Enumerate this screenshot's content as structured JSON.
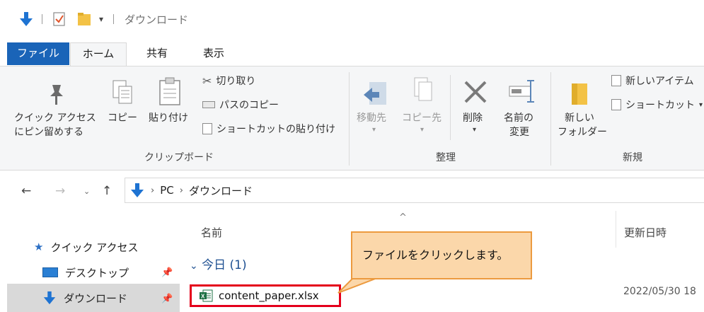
{
  "window": {
    "title": "ダウンロード",
    "quick_access_toolbar": [
      "down-arrow-icon",
      "properties-check-icon",
      "folder-icon",
      "customize-dropdown-icon"
    ]
  },
  "ribbon_tabs": [
    {
      "label": "ファイル",
      "active": false
    },
    {
      "label": "ホーム",
      "active": true
    },
    {
      "label": "共有",
      "active": false
    },
    {
      "label": "表示",
      "active": false
    }
  ],
  "ribbon": {
    "clipboard": {
      "pin_label_1": "クイック アクセス",
      "pin_label_2": "にピン留めする",
      "copy_label": "コピー",
      "paste_label": "貼り付け",
      "cut_label": "切り取り",
      "copy_path_label": "パスのコピー",
      "paste_shortcut_label": "ショートカットの貼り付け",
      "group_name": "クリップボード"
    },
    "organize": {
      "move_to_label": "移動先",
      "copy_to_label": "コピー先",
      "delete_label": "削除",
      "rename_label_1": "名前の",
      "rename_label_2": "変更",
      "group_name": "整理"
    },
    "new": {
      "new_folder_label_1": "新しい",
      "new_folder_label_2": "フォルダー",
      "new_item_label": "新しいアイテム",
      "easy_access_label": "ショートカット",
      "group_name": "新規"
    }
  },
  "address": {
    "path": [
      "PC",
      "ダウンロード"
    ]
  },
  "nav_pane": {
    "items": [
      {
        "label": "クイック アクセス",
        "icon": "star-icon"
      },
      {
        "label": "デスクトップ",
        "icon": "desktop-icon",
        "pinned": true
      },
      {
        "label": "ダウンロード",
        "icon": "download-icon",
        "pinned": true,
        "selected": true
      }
    ]
  },
  "file_list": {
    "columns": [
      "名前",
      "更新日時"
    ],
    "sort_indicator": "^",
    "group_title": "今日 (1)",
    "files": [
      {
        "name": "content_paper.xlsx",
        "modified": "2022/05/30 18",
        "icon": "excel-icon"
      }
    ]
  },
  "callout": {
    "text": "ファイルをクリックします。",
    "fill": "#fbd7aa",
    "border": "#ec9a3f"
  },
  "colors": {
    "file_tab": "#1a64b8",
    "highlight_border": "#e4001b",
    "group_title": "#1d4f91"
  }
}
